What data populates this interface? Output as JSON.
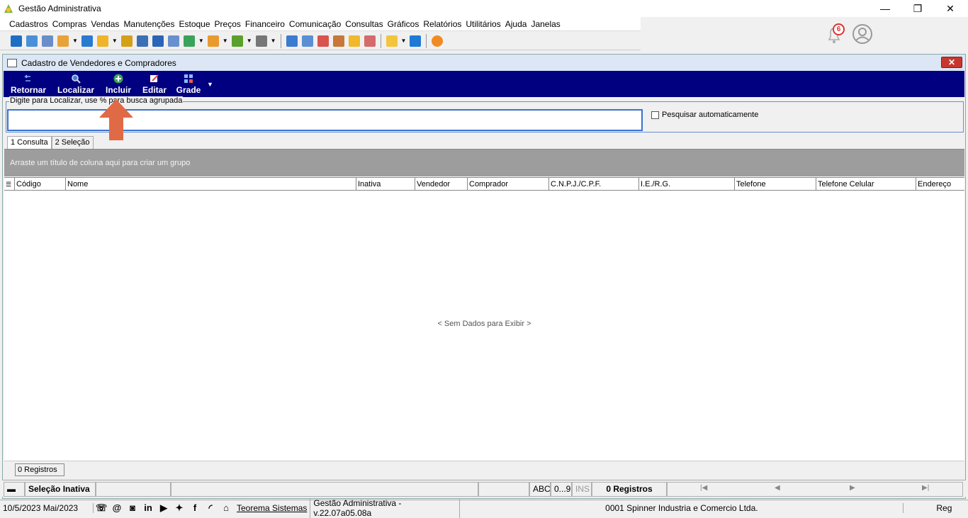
{
  "window": {
    "title": "Gestão Administrativa"
  },
  "menu": [
    "Cadastros",
    "Compras",
    "Vendas",
    "Manutenções",
    "Estoque",
    "Preços",
    "Financeiro",
    "Comunicação",
    "Consultas",
    "Gráficos",
    "Relatórios",
    "Utilitários",
    "Ajuda",
    "Janelas"
  ],
  "notifications": {
    "count": "6"
  },
  "form": {
    "title": "Cadastro de Vendedores e Compradores",
    "close_label": "✕",
    "actions": [
      {
        "label": "Retornar",
        "icon": "return-icon"
      },
      {
        "label": "Localizar",
        "icon": "search-icon"
      },
      {
        "label": "Incluir",
        "icon": "add-icon"
      },
      {
        "label": "Editar",
        "icon": "edit-icon"
      },
      {
        "label": "Grade",
        "icon": "grid-icon"
      }
    ],
    "search_label": "Digite para Localizar, use % para busca agrupada",
    "search_value": "",
    "auto_search_label": "Pesquisar automaticamente",
    "tabs": [
      "1 Consulta",
      "2 Seleção"
    ],
    "group_hint": "Arraste um título de coluna aqui para criar um grupo",
    "columns": [
      "Código",
      "Nome",
      "Inativa",
      "Vendedor",
      "Comprador",
      "C.N.P.J./C.P.F.",
      "I.E./R.G.",
      "Telefone",
      "Telefone Celular",
      "Endereço"
    ],
    "no_data": "< Sem Dados para Exibir >",
    "records_label": "0 Registros"
  },
  "status": {
    "selection": "Seleção Inativa",
    "abc": "ABC",
    "num": "0...9",
    "ins": "INS",
    "records": "0 Registros",
    "nav": [
      "|◀",
      "◀",
      "▶",
      "▶|"
    ]
  },
  "bottom": {
    "date": "10/5/2023 Mai/2023",
    "company_link": "Teorema Sistemas",
    "version": "Gestão Administrativa - v.22.07a05.08a",
    "company": "0001 Spinner Industria e Comercio Ltda.",
    "reg": "Reg"
  },
  "colors": {
    "action_bar": "#000080",
    "arrow": "#e06a45",
    "group_bar": "#9d9d9d"
  }
}
